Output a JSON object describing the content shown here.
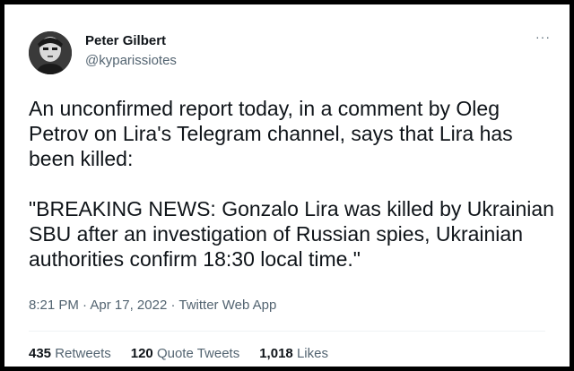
{
  "author": {
    "name": "Peter Gilbert",
    "handle": "@kyparissiotes"
  },
  "tweet": {
    "paragraph1": "An unconfirmed report today, in a comment by Oleg Petrov on Lira's Telegram channel, says that Lira has been killed:",
    "paragraph2": "\"BREAKING NEWS: Gonzalo Lira was killed by Ukrainian SBU after an investigation of Russian spies, Ukrainian authorities confirm 18:30 local time.\"",
    "time": "8:21 PM",
    "date": "Apr 17, 2022",
    "source": "Twitter Web App",
    "separator": "·"
  },
  "stats": {
    "retweets": {
      "count": "435",
      "label": "Retweets"
    },
    "quotes": {
      "count": "120",
      "label": "Quote Tweets"
    },
    "likes": {
      "count": "1,018",
      "label": "Likes"
    }
  },
  "icons": {
    "more": "more-options-icon"
  },
  "colors": {
    "text": "#0f1419",
    "secondary": "#536471",
    "frame": "#000000"
  }
}
